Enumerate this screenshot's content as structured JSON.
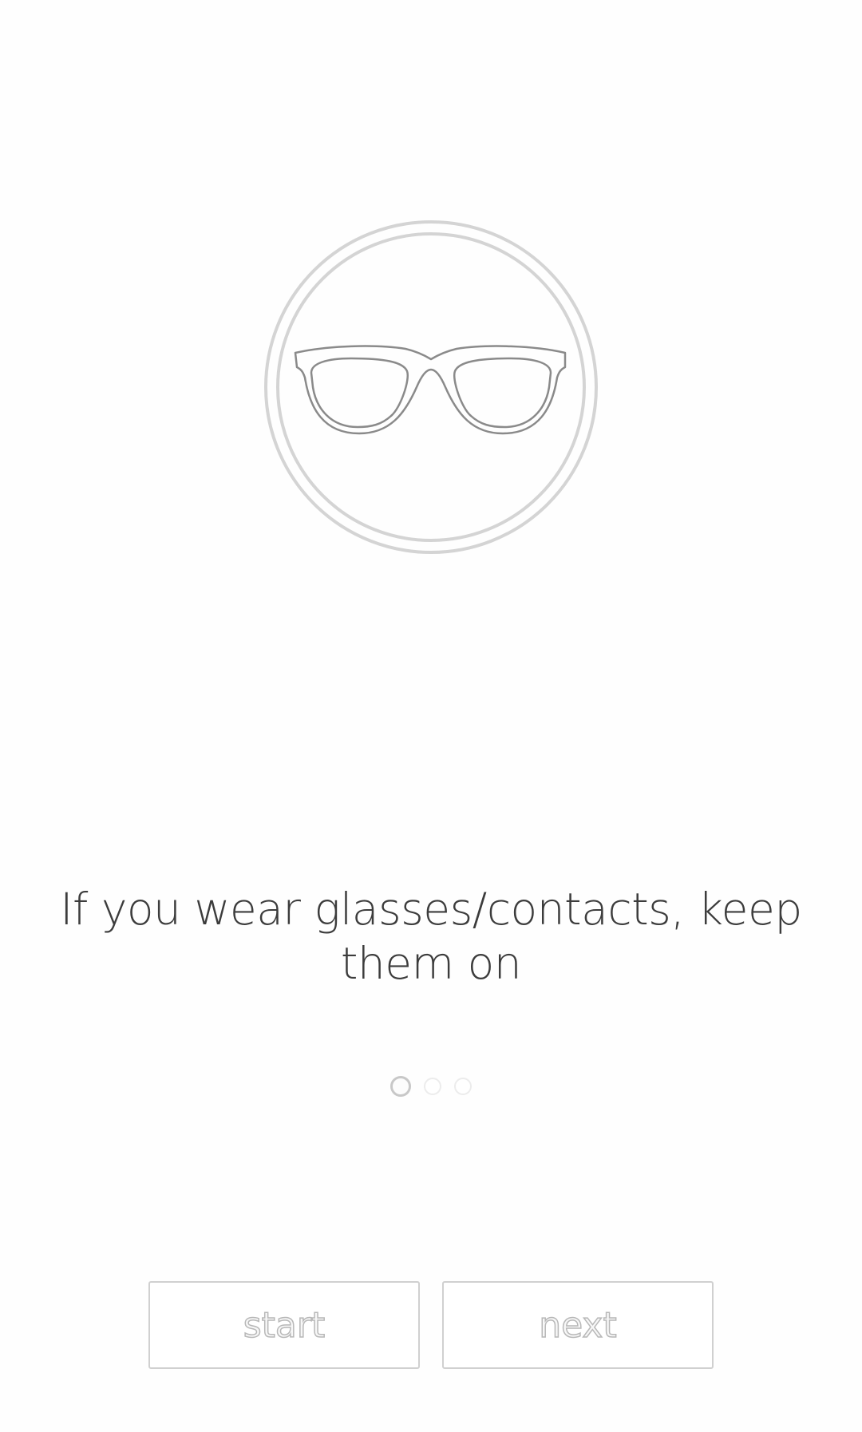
{
  "tutorial": {
    "illustration_icon": "glasses-icon",
    "message": "If you wear glasses/contacts, keep them on",
    "pager": {
      "total_pages": 3,
      "current_page": 1
    }
  },
  "actions": {
    "start_label": "start",
    "next_label": "next"
  },
  "colors": {
    "text": "#3c3c3c",
    "outline": "#c8c8c8",
    "button_border": "#d0d0d0",
    "background": "#fefefe"
  }
}
